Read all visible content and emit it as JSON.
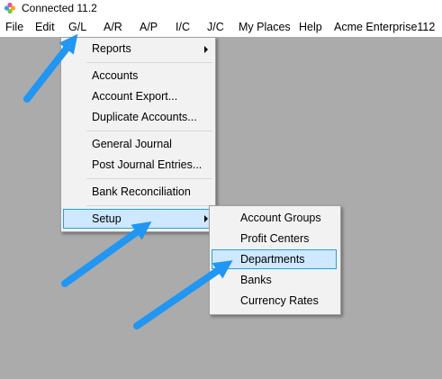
{
  "window": {
    "title": "Connected 11.2"
  },
  "menubar": {
    "items": [
      {
        "label": "File"
      },
      {
        "label": "Edit"
      },
      {
        "label": "G/L"
      },
      {
        "label": "A/R"
      },
      {
        "label": "A/P"
      },
      {
        "label": "I/C"
      },
      {
        "label": "J/C"
      },
      {
        "label": "My Places"
      },
      {
        "label": "Help"
      },
      {
        "label": "Acme Enterprise112"
      }
    ]
  },
  "gl_menu": {
    "items": [
      {
        "label": "Reports",
        "submenu": true
      },
      {
        "label": "Accounts"
      },
      {
        "label": "Account Export..."
      },
      {
        "label": "Duplicate Accounts..."
      },
      {
        "label": "General Journal"
      },
      {
        "label": "Post Journal Entries..."
      },
      {
        "label": "Bank Reconciliation"
      },
      {
        "label": "Setup",
        "submenu": true,
        "highlighted": true
      }
    ]
  },
  "setup_submenu": {
    "items": [
      {
        "label": "Account Groups"
      },
      {
        "label": "Profit Centers"
      },
      {
        "label": "Departments",
        "highlighted": true
      },
      {
        "label": "Banks"
      },
      {
        "label": "Currency Rates"
      }
    ]
  },
  "colors": {
    "desktop": "#ababab",
    "menu_bg": "#f2f2f2",
    "highlight_fill": "#cde8ff",
    "highlight_border": "#26a0da",
    "annotation_arrow": "#2196f3"
  }
}
